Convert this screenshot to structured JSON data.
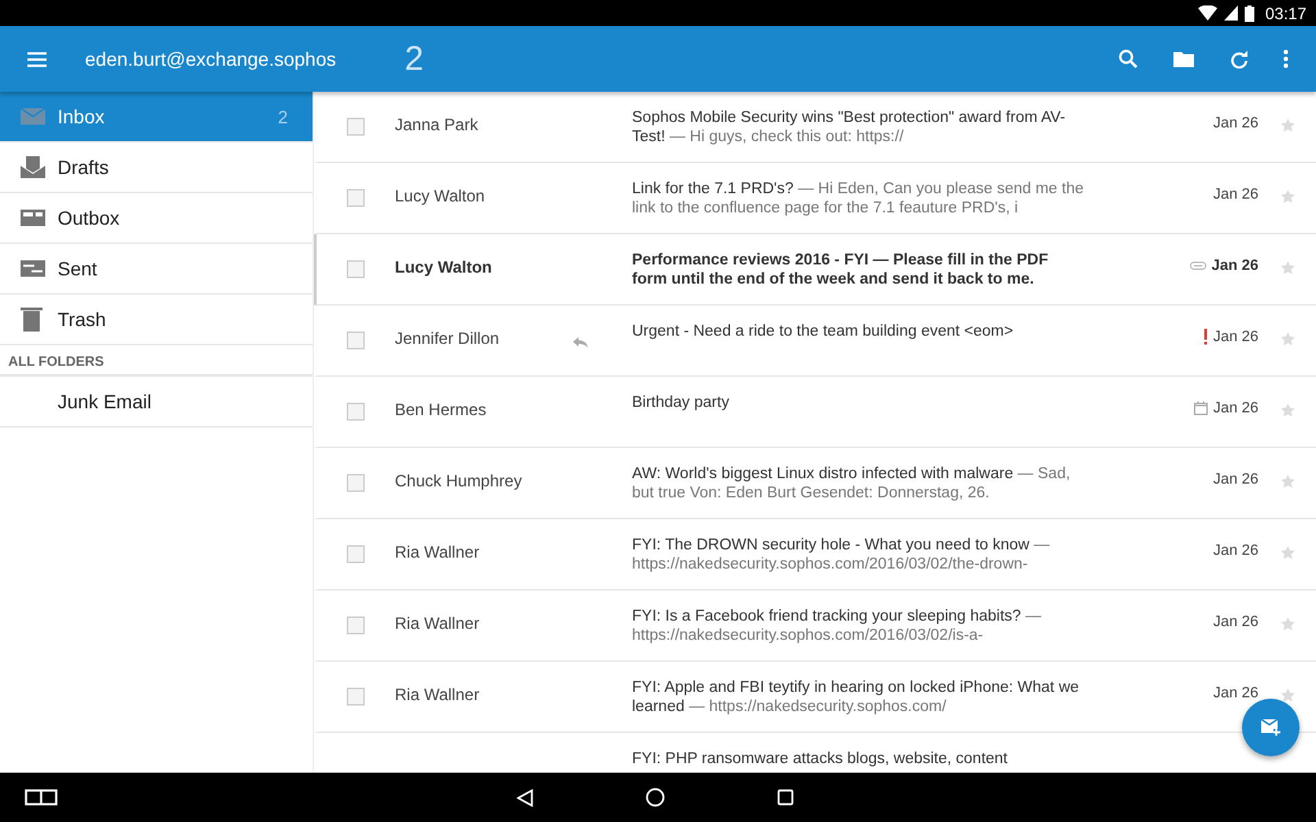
{
  "status_bar": {
    "time": "03:17"
  },
  "app_bar": {
    "account": "eden.burt@exchange.sophos",
    "unread_count": "2"
  },
  "sidebar": {
    "items": [
      {
        "kind": "inbox",
        "label": "Inbox",
        "count": "2",
        "selected": true
      },
      {
        "kind": "drafts",
        "label": "Drafts",
        "selected": false
      },
      {
        "kind": "outbox",
        "label": "Outbox",
        "selected": false
      },
      {
        "kind": "sent",
        "label": "Sent",
        "selected": false
      },
      {
        "kind": "trash",
        "label": "Trash",
        "selected": false
      }
    ],
    "section_title": "ALL FOLDERS",
    "folders": [
      {
        "label": "Junk Email",
        "selected": false
      }
    ]
  },
  "messages": [
    {
      "kind": "plain",
      "sender": "Janna Park",
      "subject": "Sophos Mobile Security wins \"Best protection\" award from AV-Test!",
      "preview": "— Hi guys, check this out: https://",
      "date": "Jan 26",
      "unread": false,
      "selected": false,
      "checked": false,
      "starred": false,
      "replied": false
    },
    {
      "kind": "plain",
      "sender": "Lucy Walton",
      "subject": "Link for the 7.1 PRD's?",
      "preview": "— Hi Eden, Can you please send me the link to the confluence page for the 7.1 feauture PRD's, i",
      "date": "Jan 26",
      "unread": false,
      "selected": false,
      "checked": false,
      "starred": false,
      "replied": false
    },
    {
      "kind": "attachment",
      "sender": "Lucy Walton",
      "subject": "Performance reviews 2016 - FYI",
      "preview": "— Please fill in the PDF form until the end of the week and send it back to me.",
      "date": "Jan 26",
      "unread": true,
      "selected": true,
      "checked": false,
      "starred": false,
      "replied": false
    },
    {
      "kind": "important",
      "sender": "Jennifer Dillon",
      "subject": "Urgent - Need a ride to the team building event <eom>",
      "date": "Jan 26",
      "unread": false,
      "selected": false,
      "checked": false,
      "starred": false,
      "replied": true
    },
    {
      "kind": "event",
      "sender": "Ben Hermes",
      "subject": "Birthday party",
      "date": "Jan 26",
      "unread": false,
      "selected": false,
      "checked": false,
      "starred": false,
      "replied": false
    },
    {
      "kind": "plain",
      "sender": "Chuck Humphrey",
      "subject": "AW: World's biggest Linux distro infected with malware",
      "preview": "— Sad, but true Von: Eden Burt Gesendet: Donnerstag, 26.",
      "date": "Jan 26",
      "unread": false,
      "selected": false,
      "checked": false,
      "starred": false,
      "replied": false
    },
    {
      "kind": "plain",
      "sender": "Ria Wallner",
      "subject": "FYI: The DROWN security hole - What you need to know",
      "preview": "— https://nakedsecurity.sophos.com/2016/03/02/the-drown-",
      "date": "Jan 26",
      "unread": false,
      "selected": false,
      "checked": false,
      "starred": false,
      "replied": false
    },
    {
      "kind": "plain",
      "sender": "Ria Wallner",
      "subject": "FYI: Is a Facebook friend tracking your sleeping habits?",
      "preview": "— https://nakedsecurity.sophos.com/2016/03/02/is-a-",
      "date": "Jan 26",
      "unread": false,
      "selected": false,
      "checked": false,
      "starred": false,
      "replied": false
    },
    {
      "kind": "plain",
      "sender": "Ria Wallner",
      "subject": "FYI: Apple and FBI teytify in hearing on locked iPhone: What we learned",
      "preview": "— https://nakedsecurity.sophos.com/",
      "date": "Jan 26",
      "unread": false,
      "selected": false,
      "checked": false,
      "starred": false,
      "replied": false
    },
    {
      "kind": "plain",
      "subject": "FYI: PHP ransomware attacks blogs, website, content",
      "unread": false,
      "selected": false
    }
  ]
}
